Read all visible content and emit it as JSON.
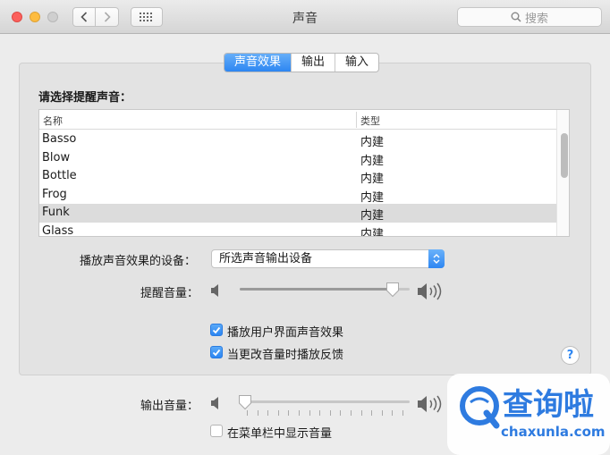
{
  "window": {
    "title": "声音"
  },
  "search": {
    "placeholder": "搜索"
  },
  "tabs": [
    {
      "label": "声音效果",
      "active": true
    },
    {
      "label": "输出",
      "active": false
    },
    {
      "label": "输入",
      "active": false
    }
  ],
  "alert_section": {
    "label": "请选择提醒声音：",
    "columns": {
      "name": "名称",
      "type": "类型"
    },
    "rows": [
      {
        "name": "Basso",
        "type": "内建",
        "selected": false
      },
      {
        "name": "Blow",
        "type": "内建",
        "selected": false
      },
      {
        "name": "Bottle",
        "type": "内建",
        "selected": false
      },
      {
        "name": "Frog",
        "type": "内建",
        "selected": false
      },
      {
        "name": "Funk",
        "type": "内建",
        "selected": true
      },
      {
        "name": "Glass",
        "type": "内建",
        "selected": false
      }
    ]
  },
  "device": {
    "label": "播放声音效果的设备：",
    "value": "所选声音输出设备"
  },
  "alert_volume": {
    "label": "提醒音量：",
    "level": 0.9
  },
  "checkboxes": [
    {
      "label": "播放用户界面声音效果",
      "checked": true
    },
    {
      "label": "当更改音量时播放反馈",
      "checked": true
    }
  ],
  "help": {
    "label": "?"
  },
  "output_volume": {
    "label": "输出音量：",
    "level": 0.03
  },
  "menu_bar_checkbox": {
    "label": "在菜单栏中显示音量",
    "checked": false
  },
  "watermark": {
    "text": "查询啦",
    "url_text": "chaxunla.com"
  },
  "colors": {
    "accent": "#2d86f2",
    "watermark": "#2e7be0"
  }
}
